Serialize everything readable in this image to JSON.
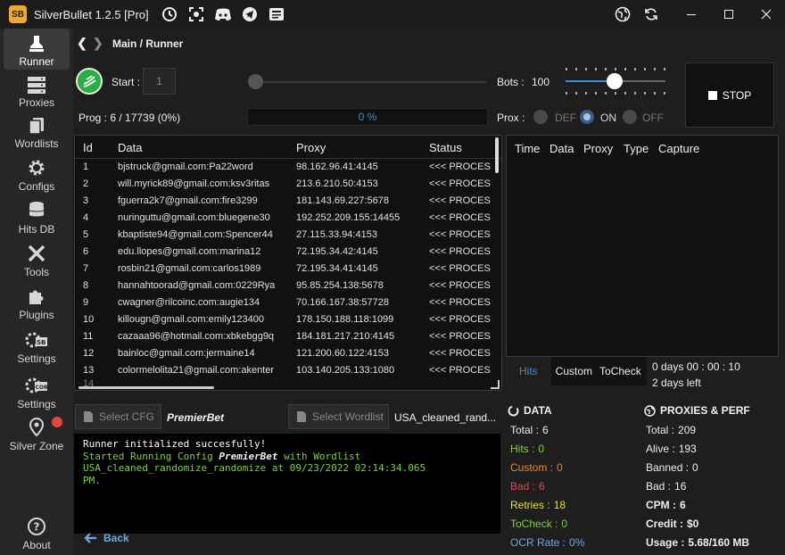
{
  "window": {
    "app_logo": "SB",
    "title": "SilverBullet 1.2.5 [Pro]",
    "icons": [
      "history-icon",
      "screenshot-icon",
      "discord-icon",
      "telegram-icon",
      "news-icon",
      "globe-icon",
      "refresh-icon"
    ],
    "controls": [
      "minimize",
      "maximize",
      "close"
    ]
  },
  "sidebar": {
    "items": [
      {
        "label": "Runner",
        "icon": "runner-icon",
        "active": true
      },
      {
        "label": "Proxies",
        "icon": "server-icon"
      },
      {
        "label": "Wordlists",
        "icon": "files-icon"
      },
      {
        "label": "Configs",
        "icon": "gear-icon"
      },
      {
        "label": "Hits DB",
        "icon": "database-icon"
      },
      {
        "label": "Tools",
        "icon": "tools-icon"
      },
      {
        "label": "Plugins",
        "icon": "puzzle-icon"
      },
      {
        "label": "Settings",
        "icon": "settings-sb-icon"
      },
      {
        "label": "Settings",
        "icon": "settings-core-icon"
      },
      {
        "label": "Silver Zone",
        "icon": "location-icon"
      },
      {
        "label": "About",
        "icon": "help-icon"
      }
    ]
  },
  "breadcrumb": "Main / Runner",
  "runner": {
    "start_label": "Start :",
    "start_value": "1",
    "bots_label": "Bots :",
    "bots_value": "100",
    "bots_fraction": 0.5,
    "stop_label": "STOP",
    "prog_text": "Prog : 6 / 17739 (0%)",
    "progress_text": "0 %",
    "progress_fraction": 0,
    "prox_label": "Prox :",
    "prox_options": [
      "DEF",
      "ON",
      "OFF"
    ],
    "prox_selected": "ON"
  },
  "data_table": {
    "columns": [
      "Id",
      "Data",
      "Proxy",
      "Status"
    ],
    "rows": [
      {
        "id": "1",
        "data": "bjstruck@gmail.com:Pa22word",
        "proxy": "98.162.96.41:4145",
        "status": "<<< PROCES"
      },
      {
        "id": "2",
        "data": "will.myrick89@gmail.com:ksv3ritas",
        "proxy": "213.6.210.50:4153",
        "status": "<<< PROCES"
      },
      {
        "id": "3",
        "data": "fguerra2k7@gmail.com:fire3299",
        "proxy": "181.143.69.227:5678",
        "status": "<<< PROCES"
      },
      {
        "id": "4",
        "data": "nuringuttu@gmail.com:bluegene30",
        "proxy": "192.252.209.155:14455",
        "status": "<<< PROCES"
      },
      {
        "id": "5",
        "data": "kbaptiste94@gmail.com:Spencer44",
        "proxy": "27.115.33.94:4153",
        "status": "<<< PROCES"
      },
      {
        "id": "6",
        "data": "edu.llopes@gmail.com:marina12",
        "proxy": "72.195.34.42:4145",
        "status": "<<< PROCES"
      },
      {
        "id": "7",
        "data": "rosbin21@gmail.com:carlos1989",
        "proxy": "72.195.34.41:4145",
        "status": "<<< PROCES"
      },
      {
        "id": "8",
        "data": "hannahtoorad@gmail.com:0229Rya",
        "proxy": "95.85.254.138:5678",
        "status": "<<< PROCES"
      },
      {
        "id": "9",
        "data": "cwagner@rilcoinc.com:augie134",
        "proxy": "70.166.167.38:57728",
        "status": "<<< PROCES"
      },
      {
        "id": "10",
        "data": "killougn@gmail.com:emily123400",
        "proxy": "178.150.188.118:1099",
        "status": "<<< PROCES"
      },
      {
        "id": "11",
        "data": "cazaaa96@hotmail.com:xbkebgg9q",
        "proxy": "184.181.217.210:4145",
        "status": "<<< PROCES"
      },
      {
        "id": "12",
        "data": "bainloc@gmail.com:jermaine14",
        "proxy": "121.200.60.122:4153",
        "status": "<<< PROCES"
      },
      {
        "id": "13",
        "data": "colormelolita21@gmail.com:akenter",
        "proxy": "103.140.205.133:1080",
        "status": "<<< PROCES"
      }
    ]
  },
  "hits_table": {
    "columns": [
      "Time",
      "Data",
      "Proxy",
      "Type",
      "Capture"
    ]
  },
  "hit_tabs": {
    "items": [
      "Hits",
      "Custom",
      "ToCheck"
    ],
    "selected": "Hits"
  },
  "timer": {
    "elapsed": "0 days 00 : 00 : 10",
    "left": "2 days left"
  },
  "config": {
    "select_cfg_label": "Select CFG",
    "cfg_name": "PremierBet",
    "select_wordlist_label": "Select Wordlist",
    "wordlist_name": "USA_cleaned_rand..."
  },
  "console": {
    "line1": "Runner initialized succesfully!",
    "line2_prefix": "Started Running Config ",
    "line2_config": "PremierBet",
    "line2_mid": "  with Wordlist",
    "line3": "USA_cleaned_randomize_randomize at 09/23/2022 02:14:34.065",
    "line4": "PM."
  },
  "back_label": "Back",
  "data_stats": {
    "title": "DATA",
    "items": [
      {
        "label": "Total :",
        "value": "6",
        "color": "#eeeeee"
      },
      {
        "label": "Hits :",
        "value": "0",
        "color": "#7fd13b"
      },
      {
        "label": "Custom :",
        "value": "0",
        "color": "#e8882e"
      },
      {
        "label": "Bad :",
        "value": "6",
        "color": "#e8453c"
      },
      {
        "label": "Retries :",
        "value": "18",
        "color": "#e6e03a"
      },
      {
        "label": "ToCheck :",
        "value": "0",
        "color": "#7fd13b"
      },
      {
        "label": "OCR Rate :",
        "value": "0%",
        "color": "#6ea6e6"
      }
    ]
  },
  "proxy_stats": {
    "title": "PROXIES & PERF",
    "items": [
      {
        "label": "Total :",
        "value": "209"
      },
      {
        "label": "Alive :",
        "value": "193"
      },
      {
        "label": "Banned :",
        "value": "0"
      },
      {
        "label": "Bad :",
        "value": "16"
      },
      {
        "label": "CPM :",
        "value": "6"
      },
      {
        "label": "Credit :",
        "value": "$0"
      },
      {
        "label": "Usage :",
        "value": "5.68/160 MB"
      }
    ]
  },
  "colors": {
    "accent": "#3b8fd6",
    "start_green": "#27ae45",
    "zone_dot": "#e8453c"
  }
}
